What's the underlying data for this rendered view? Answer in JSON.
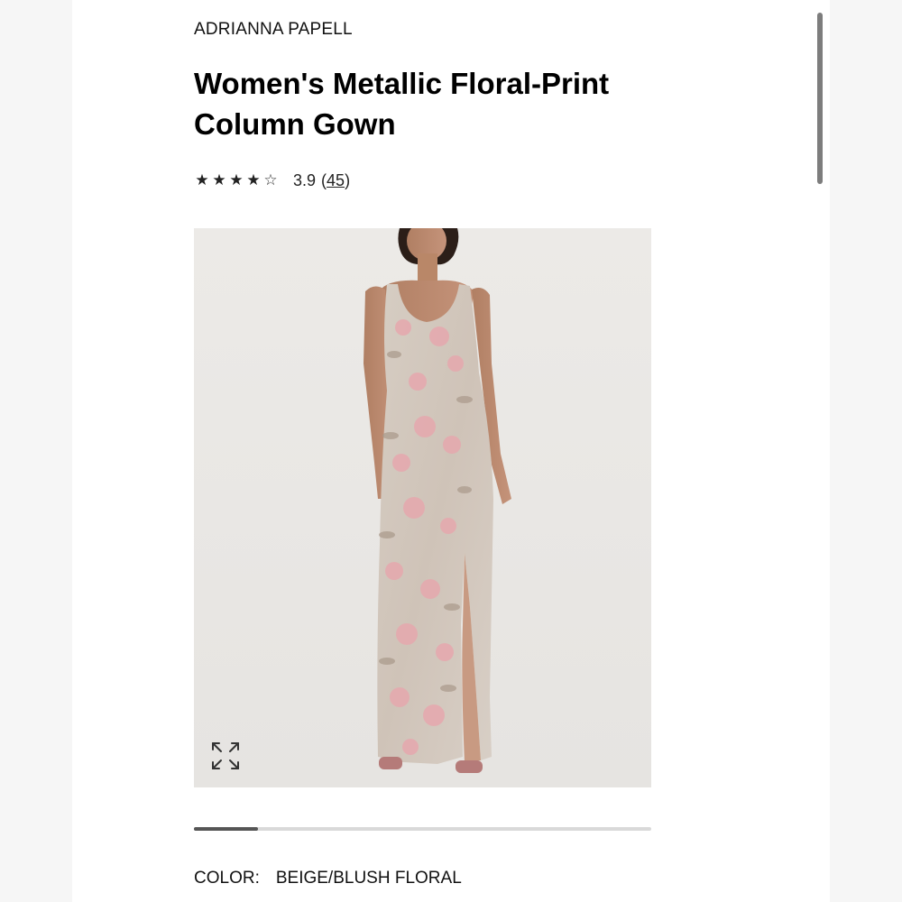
{
  "product": {
    "brand": "ADRIANNA PAPELL",
    "title": "Women's Metallic Floral-Print Column Gown",
    "rating": {
      "stars": [
        "★",
        "★",
        "★",
        "★",
        "☆"
      ],
      "value": 3.9,
      "score_text": "3.9",
      "count": "45"
    },
    "image": {
      "alt": "Model wearing beige and blush floral column gown with front slit"
    },
    "gallery": {
      "position_fraction": 0.14
    },
    "color": {
      "label": "COLOR:",
      "value": "BEIGE/BLUSH FLORAL"
    }
  },
  "icons": {
    "expand": "expand-arrows-icon"
  },
  "colors": {
    "background": "#ffffff",
    "photo_background": "#e9e8e6",
    "progress_track": "#d9d9d9",
    "progress_fill": "#555555"
  }
}
